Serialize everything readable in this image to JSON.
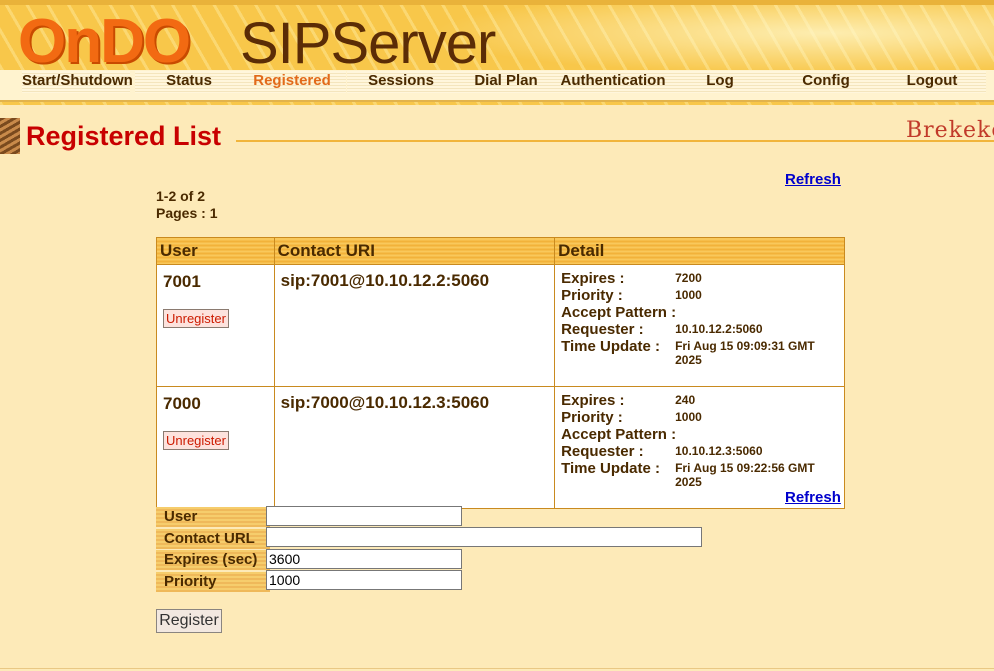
{
  "header": {
    "logo_ondo": "OnDO",
    "logo_sip": "SIPServer"
  },
  "nav": [
    {
      "label": "Start/Shutdown",
      "active": false
    },
    {
      "label": "Status",
      "active": false
    },
    {
      "label": "Registered",
      "active": true
    },
    {
      "label": "Sessions",
      "active": false
    },
    {
      "label": "Dial Plan",
      "active": false
    },
    {
      "label": "Authentication",
      "active": false
    },
    {
      "label": "Log",
      "active": false
    },
    {
      "label": "Config",
      "active": false
    },
    {
      "label": "Logout",
      "active": false
    }
  ],
  "page": {
    "title": "Registered List",
    "brand": "Brekeke"
  },
  "list": {
    "refresh_label": "Refresh",
    "range": "1-2 of 2",
    "pages": "Pages : 1",
    "columns": [
      "User",
      "Contact URI",
      "Detail"
    ],
    "detail_labels": {
      "expires": "Expires :",
      "priority": "Priority :",
      "accept": "Accept Pattern :",
      "requester": "Requester :",
      "time_update": "Time Update :"
    },
    "unregister_label": "Unregister",
    "rows": [
      {
        "user": "7001",
        "contact": "sip:7001@10.10.12.2:5060",
        "expires": "7200",
        "priority": "1000",
        "accept": "",
        "requester": "10.10.12.2:5060",
        "time_update": "Fri Aug 15 09:09:31 GMT 2025"
      },
      {
        "user": "7000",
        "contact": "sip:7000@10.10.12.3:5060",
        "expires": "240",
        "priority": "1000",
        "accept": "",
        "requester": "10.10.12.3:5060",
        "time_update": "Fri Aug 15 09:22:56 GMT 2025"
      }
    ]
  },
  "form": {
    "user_label": "User",
    "user_value": "",
    "contact_label": "Contact URL",
    "contact_value": "",
    "expires_label": "Expires (sec)",
    "expires_value": "3600",
    "priority_label": "Priority",
    "priority_value": "1000",
    "register_label": "Register"
  },
  "colors": {
    "accent": "#c80000",
    "link": "#0000cc",
    "header": "#f8c74a",
    "background": "#fdeab8"
  }
}
